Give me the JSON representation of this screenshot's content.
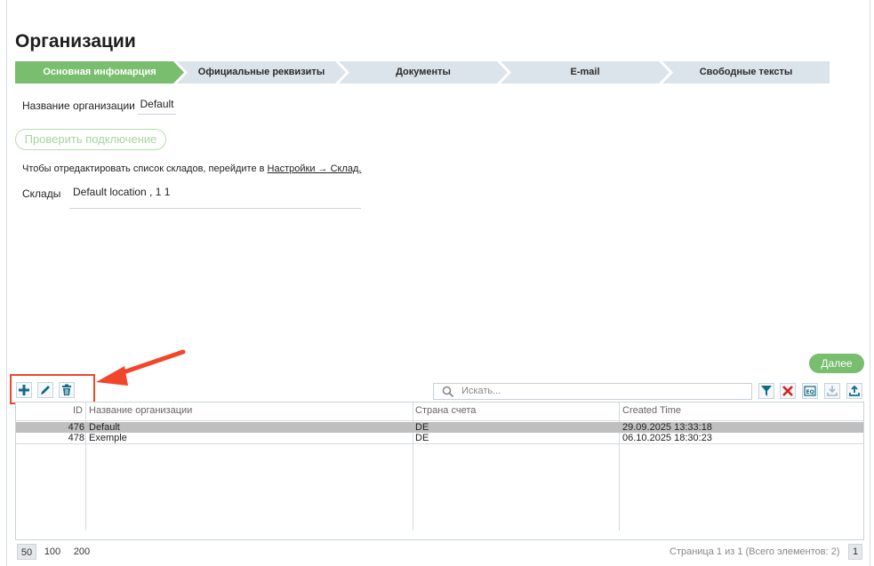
{
  "page": {
    "title": "Организации"
  },
  "wizard": {
    "steps": [
      {
        "label": "Основная инфомарция",
        "active": true
      },
      {
        "label": "Официальные реквизиты",
        "active": false
      },
      {
        "label": "Документы",
        "active": false
      },
      {
        "label": "E-mail",
        "active": false
      },
      {
        "label": "Свободные тексты",
        "active": false
      }
    ]
  },
  "form": {
    "org_name_label": "Название организации",
    "org_name_value": "Default",
    "check_connection_label": "Проверить подключение",
    "hint_text": "Чтобы отредактировать список складов, перейдите в",
    "hint_link": "Настройки → Склад.",
    "warehouses_label": "Склады",
    "warehouses_value": "Default location , 1 1",
    "next_label": "Далее"
  },
  "toolbar": {
    "add_icon": "plus-icon",
    "edit_icon": "pencil-icon",
    "delete_icon": "trash-icon",
    "search_placeholder": "Искать...",
    "right_icons": [
      "filter-icon",
      "clear-filter-icon",
      "search-table-icon",
      "import-icon",
      "export-icon"
    ]
  },
  "table": {
    "headers": {
      "id": "ID",
      "name": "Название организации",
      "country": "Страна счета",
      "created": "Created Time"
    },
    "rows": [
      {
        "id": "476",
        "name": "Default",
        "country": "DE",
        "created": "29.09.2025 13:33:18",
        "selected": true
      },
      {
        "id": "478",
        "name": "Exemple",
        "country": "DE",
        "created": "06.10.2025 18:30:23",
        "selected": false
      }
    ]
  },
  "pager": {
    "sizes": [
      "50",
      "100",
      "200"
    ],
    "active_size": "50",
    "info": "Страница 1 из 1 (Всего элементов: 2)",
    "current_page": "1"
  },
  "colors": {
    "accent": "#79bd6e",
    "step_inactive": "#dbe4ea",
    "highlight": "#f2462b",
    "icon": "#156a8a"
  }
}
